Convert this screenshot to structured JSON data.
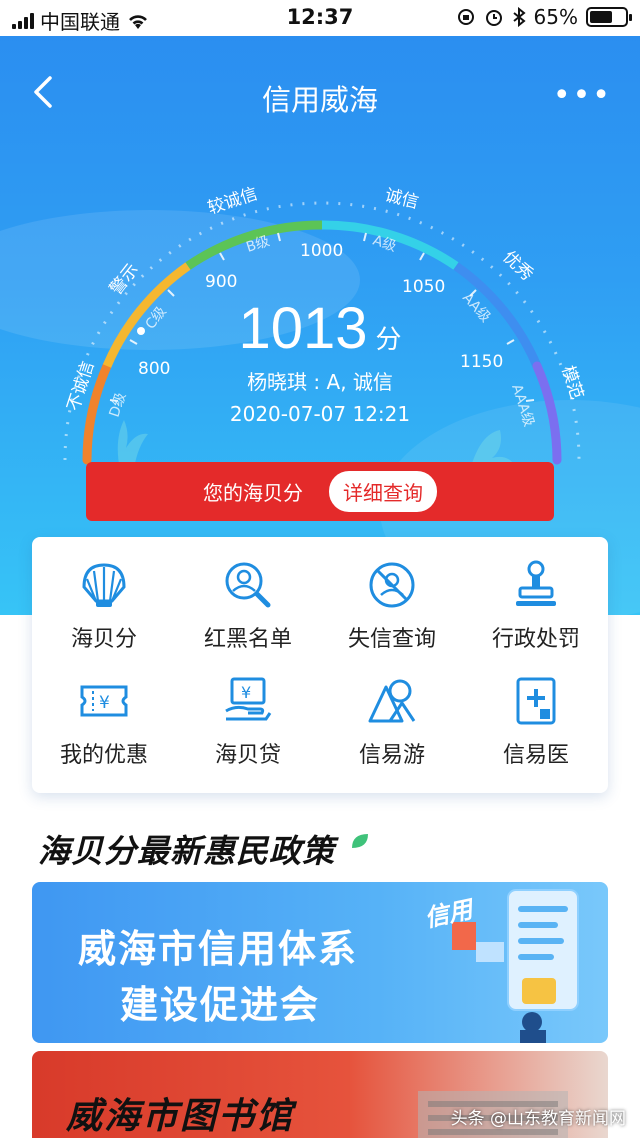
{
  "status_bar": {
    "carrier": "中国联通",
    "time": "12:37",
    "battery": "65%",
    "battery_level": 0.65
  },
  "nav": {
    "title": "信用威海",
    "more": "•••"
  },
  "gauge": {
    "grades": [
      "不诚信",
      "警示",
      "较诚信",
      "诚信",
      "优秀",
      "模范"
    ],
    "levels": [
      "D级",
      "C级",
      "B级",
      "A级",
      "AA级",
      "AAA级"
    ],
    "ticks": [
      "800",
      "900",
      "1000",
      "1050",
      "1150"
    ]
  },
  "score": {
    "value": "1013",
    "unit": "分",
    "person": "杨晓琪 : A, 诚信",
    "datetime": "2020-07-07 12:21"
  },
  "banner_bar": {
    "label": "您的海贝分",
    "button": "详细查询"
  },
  "services": [
    {
      "label": "海贝分",
      "icon": "shell-icon"
    },
    {
      "label": "红黑名单",
      "icon": "person-search-icon"
    },
    {
      "label": "失信查询",
      "icon": "person-forbidden-icon"
    },
    {
      "label": "行政处罚",
      "icon": "stamp-icon"
    },
    {
      "label": "我的优惠",
      "icon": "coupon-icon"
    },
    {
      "label": "海贝贷",
      "icon": "loan-icon"
    },
    {
      "label": "信易游",
      "icon": "mountain-icon"
    },
    {
      "label": "信易医",
      "icon": "medical-icon"
    }
  ],
  "section": {
    "title": "海贝分最新惠民政策"
  },
  "banner1": {
    "line1": "威海市信用体系",
    "line2": "建设促进会",
    "tag": "信用"
  },
  "banner2": {
    "title": "威海市图书馆"
  },
  "watermark": "头条 @山东教育新闻网",
  "colors": {
    "hero_top": "#2a8cf0",
    "hero_bottom": "#37c4f6",
    "red": "#e42a2a",
    "icon_blue": "#1f8de0"
  }
}
